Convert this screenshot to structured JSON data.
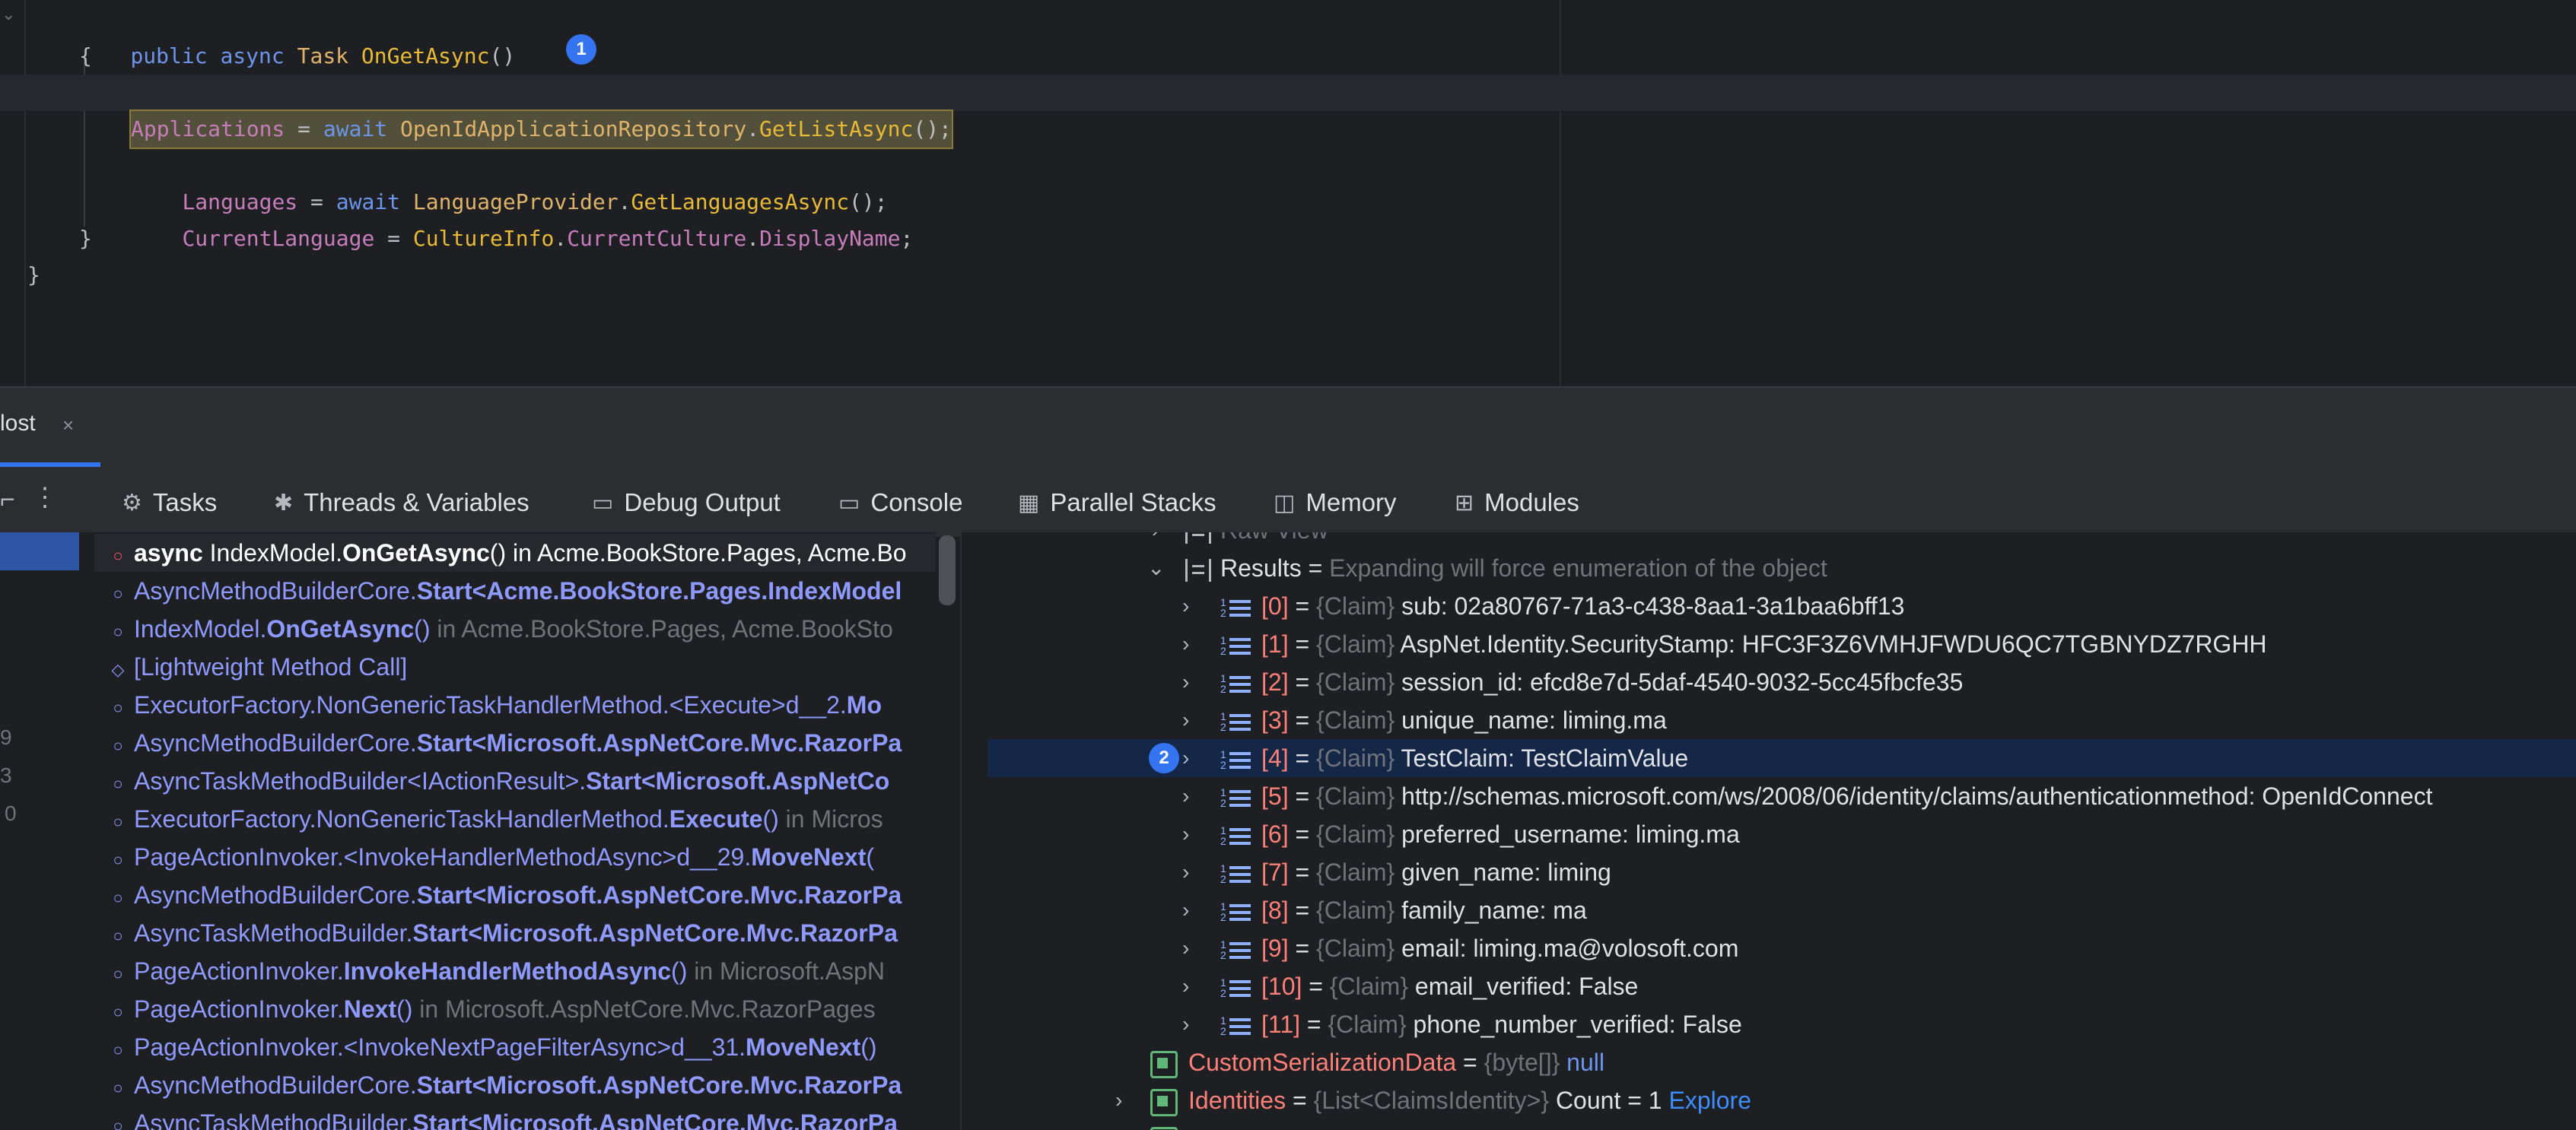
{
  "editor": {
    "lines": {
      "l1": {
        "kw_public": "public",
        "kw_async": "async",
        "type": "Task",
        "method": "OnGetAsync",
        "rest": "()"
      },
      "l2": "{",
      "l3": {
        "lhs": "Applications",
        "op": " = ",
        "await": "await",
        "repo": "OpenIdApplicationRepository",
        "dot": ".",
        "call": "GetListAsync",
        "end": "();"
      },
      "l5": {
        "lhs": "Languages",
        "op": " = ",
        "await": "await",
        "provider": "LanguageProvider",
        "dot": ".",
        "call": "GetLanguagesAsync",
        "end": "();"
      },
      "l6": {
        "lhs": "CurrentLanguage",
        "op": " = ",
        "cls": "CultureInfo",
        "dot1": ".",
        "p1": "CurrentCulture",
        "dot2": ".",
        "p2": "DisplayName",
        "end": ";"
      },
      "l7": "}",
      "l8": "}"
    },
    "badge1": "1"
  },
  "debug": {
    "session_tab": {
      "label": "lost",
      "close": "×"
    },
    "tabs": [
      {
        "icon": "⚙",
        "label": "Tasks"
      },
      {
        "icon": "✱",
        "label": "Threads & Variables"
      },
      {
        "icon": "▭",
        "label": "Debug Output"
      },
      {
        "icon": "▭",
        "label": "Console"
      },
      {
        "icon": "▦",
        "label": "Parallel Stacks"
      },
      {
        "icon": "◫",
        "label": "Memory"
      },
      {
        "icon": "⊞",
        "label": "Modules"
      }
    ],
    "left_numbers": [
      "9",
      "3",
      "0"
    ],
    "frames": [
      {
        "a": "async",
        "b": " IndexModel.",
        "c": "OnGetAsync",
        "d": "() in Acme.BookStore.Pages, Acme.Bo"
      },
      {
        "a": "AsyncMethodBuilderCore.",
        "b": "Start<Acme.BookStore.Pages.IndexModel"
      },
      {
        "a": "IndexModel.",
        "b": "OnGetAsync",
        "c": "()",
        "d": " in Acme.BookStore.Pages, Acme.BookSto"
      },
      {
        "a": "[Lightweight Method Call]"
      },
      {
        "a": "ExecutorFactory.NonGenericTaskHandlerMethod.<Execute>d__2.",
        "b": "Mo"
      },
      {
        "a": "AsyncMethodBuilderCore.",
        "b": "Start<Microsoft.AspNetCore.Mvc.RazorPa"
      },
      {
        "a": "AsyncTaskMethodBuilder<IActionResult>.",
        "b": "Start<Microsoft.AspNetCo"
      },
      {
        "a": "ExecutorFactory.NonGenericTaskHandlerMethod.",
        "b": "Execute",
        "c": "()",
        "d": " in Micros"
      },
      {
        "a": "PageActionInvoker.<InvokeHandlerMethodAsync>d__29.",
        "b": "MoveNext",
        "c": "("
      },
      {
        "a": "AsyncMethodBuilderCore.",
        "b": "Start<Microsoft.AspNetCore.Mvc.RazorPa"
      },
      {
        "a": "AsyncTaskMethodBuilder.",
        "b": "Start<Microsoft.AspNetCore.Mvc.RazorPa"
      },
      {
        "a": "PageActionInvoker.",
        "b": "InvokeHandlerMethodAsync",
        "c": "()",
        "d": " in Microsoft.AspN"
      },
      {
        "a": "PageActionInvoker.",
        "b": "Next",
        "c": "()",
        "d": " in Microsoft.AspNetCore.Mvc.RazorPages"
      },
      {
        "a": "PageActionInvoker.<InvokeNextPageFilterAsync>d__31.",
        "b": "MoveNext",
        "c": "()"
      },
      {
        "a": "AsyncMethodBuilderCore.",
        "b": "Start<Microsoft.AspNetCore.Mvc.RazorPa"
      },
      {
        "a": "AsyncTaskMethodBuilder.",
        "b": "Start<Microsoft.AspNetCore.Mvc.RazorPa"
      }
    ],
    "vars": {
      "raw_view": "Raw View",
      "results": {
        "name": "Results",
        "eq": " = ",
        "note": "Expanding will force enumeration of the object"
      },
      "claim_type": "{Claim}",
      "claims": [
        {
          "idx": "[0]",
          "value": "sub: 02a80767-71a3-c438-8aa1-3a1baa6bff13"
        },
        {
          "idx": "[1]",
          "value": "AspNet.Identity.SecurityStamp: HFC3F3Z6VMHJFWDU6QC7TGBNYDZ7RGHH"
        },
        {
          "idx": "[2]",
          "value": "session_id: efcd8e7d-5daf-4540-9032-5cc45fbcfe35"
        },
        {
          "idx": "[3]",
          "value": "unique_name: liming.ma"
        },
        {
          "idx": "[4]",
          "value": "TestClaim: TestClaimValue"
        },
        {
          "idx": "[5]",
          "value": "http://schemas.microsoft.com/ws/2008/06/identity/claims/authenticationmethod: OpenIdConnect"
        },
        {
          "idx": "[6]",
          "value": "preferred_username: liming.ma"
        },
        {
          "idx": "[7]",
          "value": "given_name: liming"
        },
        {
          "idx": "[8]",
          "value": "family_name: ma"
        },
        {
          "idx": "[9]",
          "value": "email: liming.ma@volosoft.com"
        },
        {
          "idx": "[10]",
          "value": "email_verified: False"
        },
        {
          "idx": "[11]",
          "value": "phone_number_verified: False"
        }
      ],
      "badge2": "2",
      "custom": {
        "name": "CustomSerializationData",
        "eq": " = ",
        "type": "{byte[]}",
        "value": "null"
      },
      "identities": {
        "name": "Identities",
        "eq": " = ",
        "type": "{List<ClaimsIdentity>}",
        "count": "Count = 1",
        "explore": "Explore"
      }
    }
  }
}
